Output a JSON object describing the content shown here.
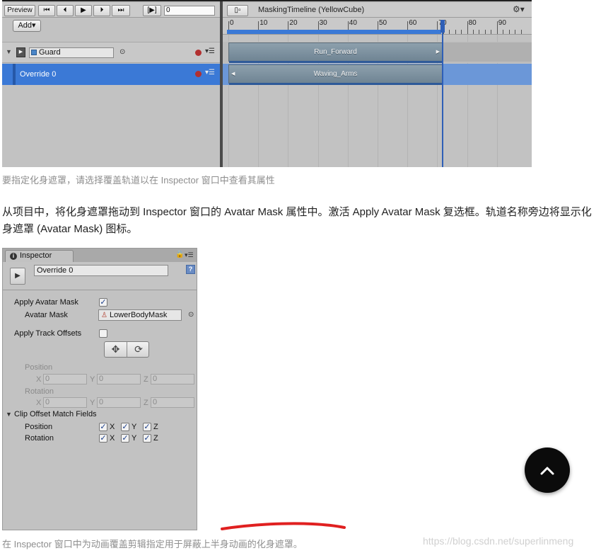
{
  "timeline": {
    "toolbar": {
      "preview_label": "Preview",
      "frame_value": "0",
      "add_label": "Add▾"
    },
    "asset_title": "MaskingTimeline (YellowCube)",
    "ruler_ticks": [
      "0",
      "10",
      "20",
      "30",
      "40",
      "50",
      "60",
      "70",
      "80",
      "90"
    ],
    "tracks": [
      {
        "name": "Guard",
        "clip": "Run_Forward"
      },
      {
        "name": "Override 0",
        "clip": "Waving_Arms"
      }
    ]
  },
  "caption_top": "要指定化身遮罩，请选择覆盖轨道以在 Inspector 窗口中查看其属性",
  "paragraph": "从项目中，将化身遮罩拖动到 Inspector 窗口的 Avatar Mask 属性中。激活 Apply Avatar Mask 复选框。轨道名称旁边将显示化身遮罩 (Avatar Mask) 图标。",
  "inspector": {
    "tab_label": "Inspector",
    "object_name": "Override 0",
    "apply_avatar_mask": {
      "label": "Apply Avatar Mask",
      "checked": true
    },
    "avatar_mask": {
      "label": "Avatar Mask",
      "value": "LowerBodyMask"
    },
    "apply_track_offsets": {
      "label": "Apply Track Offsets",
      "checked": false
    },
    "position": {
      "label": "Position",
      "x": "0",
      "y": "0",
      "z": "0"
    },
    "rotation": {
      "label": "Rotation",
      "x": "0",
      "y": "0",
      "z": "0"
    },
    "clip_offset_section": "Clip Offset Match Fields",
    "match_position_label": "Position",
    "match_rotation_label": "Rotation",
    "axis_x": "X",
    "axis_y": "Y",
    "axis_z": "Z"
  },
  "caption_bottom": "在 Inspector 窗口中为动画覆盖剪辑指定用于屏蔽上半身动画的化身遮罩。",
  "watermark": "https://blog.csdn.net/superlinmeng",
  "colors": {
    "selection_blue": "#3b79d6",
    "clip_grey": "#7f93a1",
    "record_red": "#b23030",
    "scribble_red": "#e02020"
  }
}
